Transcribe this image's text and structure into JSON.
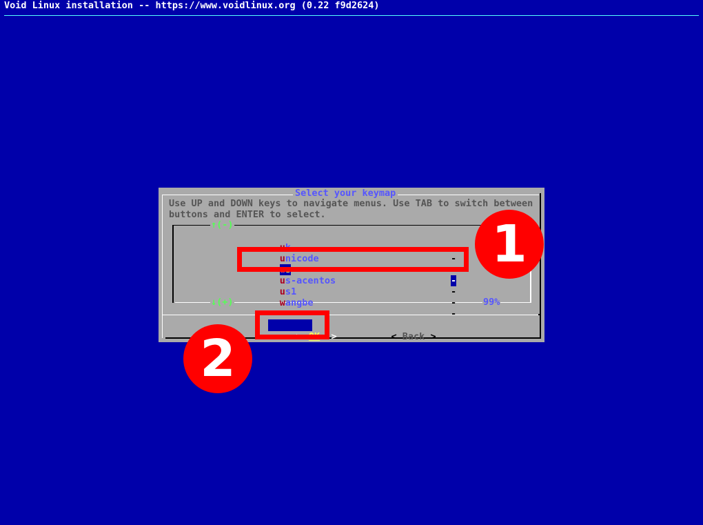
{
  "window": {
    "title": "Void Linux installation -- https://www.voidlinux.org (0.22 f9d2624)"
  },
  "dialog": {
    "title": "Select your keymap",
    "prompt": "Use UP and DOWN keys to navigate menus. Use TAB to switch between buttons and ENTER to select.",
    "scroll_up": "↑(-)",
    "scroll_down": "↓(+)",
    "scroll_percent": "99%",
    "items": [
      {
        "hotkey": "u",
        "rest": "k",
        "desc": "-",
        "selected": false
      },
      {
        "hotkey": "u",
        "rest": "nicode",
        "desc": "-",
        "selected": false
      },
      {
        "hotkey": "u",
        "rest": "s",
        "desc": "-",
        "selected": true
      },
      {
        "hotkey": "u",
        "rest": "s-acentos",
        "desc": "-",
        "selected": false
      },
      {
        "hotkey": "u",
        "rest": "s1",
        "desc": "-",
        "selected": false
      },
      {
        "hotkey": "w",
        "rest": "angbe",
        "desc": "-",
        "selected": false
      }
    ],
    "buttons": {
      "ok_label": "OK",
      "back_label": "Back",
      "left_bracket": "<",
      "right_bracket": ">"
    }
  },
  "annotations": {
    "badge_1": "1",
    "badge_2": "2",
    "color": "#ff0000"
  }
}
